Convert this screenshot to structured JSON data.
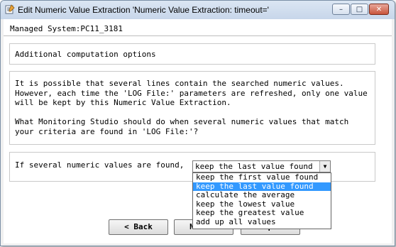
{
  "window": {
    "title": "Edit Numeric Value Extraction 'Numeric Value Extraction: timeout='",
    "minimize": "–",
    "maximize": "□",
    "close": "✕"
  },
  "managed_system": "Managed System:PC11_3181",
  "section_title": "Additional computation options",
  "description": "It is possible that several lines contain the searched numeric values.\nHowever, each time the 'LOG File:' parameters are refreshed, only one value\nwill be kept by this Numeric Value Extraction.\n\nWhat Monitoring Studio should do when several numeric values that match\nyour criteria are found in 'LOG File:'?",
  "question_label": "If several numeric values are found,",
  "select": {
    "value": "keep the last value found",
    "arrow": "▼",
    "options": [
      "keep the first value found",
      "keep the last value found",
      "calculate the average",
      "keep the lowest value",
      "keep the greatest value",
      "add up all values"
    ],
    "selected_index": 1
  },
  "buttons": {
    "back": "< Back",
    "next": "Next >",
    "help": "Help >>"
  }
}
